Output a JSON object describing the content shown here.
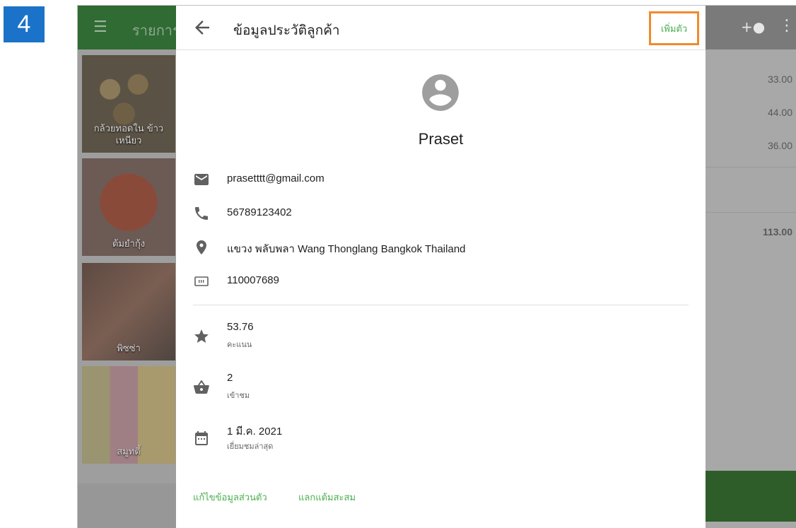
{
  "step_number": "4",
  "background": {
    "title": "รายการ",
    "tiles": [
      {
        "label": "กล้วยทอดใน ข้าวเหนียว"
      },
      {
        "label": "ต้มยำกุ้ง"
      },
      {
        "label": "พิซซ่า"
      },
      {
        "label": "สมูทตี้"
      }
    ],
    "prices": [
      "33.00",
      "44.00",
      "36.00"
    ],
    "total": "113.00"
  },
  "dialog": {
    "title": "ข้อมูลประวัติลูกค้า",
    "add_label": "เพิ่มตัว",
    "customer": {
      "name": "Praset",
      "email": "prasetttt@gmail.com",
      "phone": "56789123402",
      "address": "แขวง พลับพลา Wang Thonglang Bangkok Thailand",
      "id_number": "110007689"
    },
    "stats": [
      {
        "value": "53.76",
        "label": "คะแนน",
        "icon": "star-icon"
      },
      {
        "value": "2",
        "label": "เข้าชม",
        "icon": "basket-icon"
      },
      {
        "value": "1 มี.ค. 2021",
        "label": "เยี่ยมชมล่าสุด",
        "icon": "calendar-icon"
      }
    ],
    "footer": {
      "edit_label": "แก้ไขข้อมูลส่วนตัว",
      "redeem_label": "แลกแต้มสะสม"
    }
  },
  "colors": {
    "accent_green": "#4caf50",
    "highlight_orange": "#f08a2c",
    "badge_blue": "#1a73c8"
  }
}
